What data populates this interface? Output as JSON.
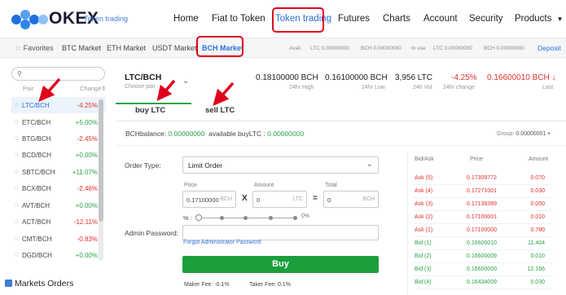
{
  "brand": {
    "name": "OKEX",
    "sub": "Token trading"
  },
  "nav": {
    "items": [
      "Home",
      "Fiat to Token",
      "Token trading",
      "Futures",
      "Charts",
      "Account",
      "Security"
    ],
    "products": "Products"
  },
  "market_bar": {
    "favorites": "Favorites",
    "tabs": [
      "BTC Market",
      "ETH Market",
      "USDT Market",
      "BCH Market"
    ],
    "avail_label": "Avail.",
    "avail_ltc": "LTC 0.00000000",
    "avail_bch": "BCH 0.00000000",
    "in_use_label": "In use",
    "in_use_ltc": "LTC 0.00000000",
    "in_use_bch": "BCH 0.00000000",
    "deposit": "Deposit"
  },
  "sidebar": {
    "search_placeholder": "",
    "col_pair": "Pair",
    "col_change": "Change",
    "pairs": [
      {
        "name": "LTC/BCH",
        "change": "-4.25%",
        "dir": "down"
      },
      {
        "name": "ETC/BCH",
        "change": "+5.00%",
        "dir": "up"
      },
      {
        "name": "BTG/BCH",
        "change": "-2.45%",
        "dir": "down"
      },
      {
        "name": "BCD/BCH",
        "change": "+0.00%",
        "dir": "up"
      },
      {
        "name": "SBTC/BCH",
        "change": "+11.07%",
        "dir": "up"
      },
      {
        "name": "BCX/BCH",
        "change": "-2.46%",
        "dir": "down"
      },
      {
        "name": "AVT/BCH",
        "change": "+0.00%",
        "dir": "up"
      },
      {
        "name": "ACT/BCH",
        "change": "-12.11%",
        "dir": "down"
      },
      {
        "name": "CMT/BCH",
        "change": "-0.83%",
        "dir": "down"
      },
      {
        "name": "DGD/BCH",
        "change": "+0.00%",
        "dir": "up"
      }
    ],
    "markets_orders": "Markets Orders"
  },
  "pair_header": {
    "pair": "LTC/BCH",
    "choose": "Choose pair",
    "high": "0.18100000 BCH",
    "high_label": "24hr High",
    "low": "0.16100000 BCH",
    "low_label": "24hr Low",
    "vol": "3,956 LTC",
    "vol_label": "24h Vol",
    "change": "-4.25%",
    "change_label": "24hr change",
    "last": "0.16600010 BCH",
    "last_label": "Last"
  },
  "tabs": {
    "buy": "buy LTC",
    "sell": "sell LTC"
  },
  "balance": {
    "label": "BCHbalance:",
    "value": "0.00000000",
    "avail_label": "available buyLTC :",
    "avail_value": "0.00000000",
    "group_label": "Group:",
    "group_value": "0.00000001"
  },
  "form": {
    "order_type_label": "Order Type:",
    "order_type_value": "Limit Order",
    "price_label": "Price",
    "price_value": "0.17100000",
    "price_unit": "BCH",
    "amount_label": "Amount",
    "amount_value": "0",
    "amount_unit": "LTC",
    "total_label": "Total",
    "total_value": "0",
    "total_unit": "BCH",
    "times": "X",
    "equals": "=",
    "pct_label": "% :",
    "pct_value": "0%",
    "admin_pwd_label": "Admin Password:",
    "forgot": "Forgot Administrator Password",
    "buy_button": "Buy",
    "maker_fee": "Maker Fee:  -0.1%",
    "taker_fee": "Taker Fee:  0.1%"
  },
  "orderbook": {
    "headers": [
      "Bid/Ask",
      "Price",
      "Amount"
    ],
    "rows": [
      {
        "side": "Ask (5)",
        "price": "0.17309772",
        "amount": "0.070",
        "type": "ask"
      },
      {
        "side": "Ask (4)",
        "price": "0.17271001",
        "amount": "0.030",
        "type": "ask"
      },
      {
        "side": "Ask (3)",
        "price": "0.17138389",
        "amount": "0.050",
        "type": "ask"
      },
      {
        "side": "Ask (2)",
        "price": "0.17100001",
        "amount": "0.010",
        "type": "ask"
      },
      {
        "side": "Ask (1)",
        "price": "0.17100000",
        "amount": "0.780",
        "type": "ask"
      },
      {
        "side": "Bid (1)",
        "price": "0.16600010",
        "amount": "11.404",
        "type": "bid"
      },
      {
        "side": "Bid (2)",
        "price": "0.16600009",
        "amount": "0.010",
        "type": "bid"
      },
      {
        "side": "Bid (3)",
        "price": "0.16600000",
        "amount": "12.166",
        "type": "bid"
      },
      {
        "side": "Bid (4)",
        "price": "0.16434009",
        "amount": "0.030",
        "type": "bid"
      }
    ]
  },
  "colors": {
    "accent": "#2e6fd8",
    "up": "#2ba34a",
    "down": "#e0312f",
    "buy": "#1b9f3d",
    "highlight": "#e0001b"
  }
}
